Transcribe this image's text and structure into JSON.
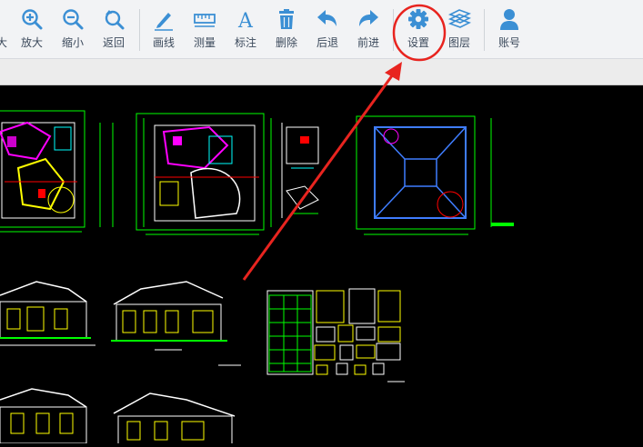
{
  "toolbar": {
    "items": [
      {
        "id": "zoom-in-partial",
        "label": "大"
      },
      {
        "id": "zoom-in",
        "label": "放大"
      },
      {
        "id": "zoom-out",
        "label": "缩小"
      },
      {
        "id": "back",
        "label": "返回"
      },
      {
        "id": "draw-line",
        "label": "画线"
      },
      {
        "id": "measure",
        "label": "测量"
      },
      {
        "id": "annotate",
        "label": "标注"
      },
      {
        "id": "delete",
        "label": "删除"
      },
      {
        "id": "undo",
        "label": "后退"
      },
      {
        "id": "redo",
        "label": "前进"
      },
      {
        "id": "settings",
        "label": "设置"
      },
      {
        "id": "layers",
        "label": "图层"
      },
      {
        "id": "account",
        "label": "账号"
      }
    ],
    "icon_color": "#3b8fd4",
    "highlight_color": "#e8241f"
  }
}
